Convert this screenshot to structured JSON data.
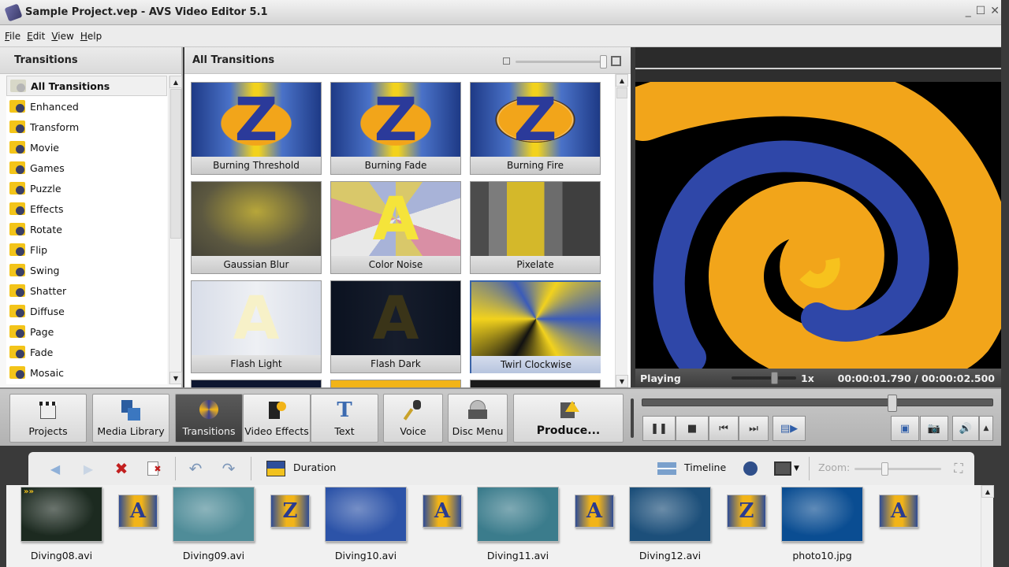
{
  "window": {
    "title": "Sample Project.vep - AVS Video Editor 5.1",
    "controls": {
      "minimize": "_",
      "maximize": "☐",
      "close": "✕"
    }
  },
  "menu": [
    "File",
    "Edit",
    "View",
    "Help"
  ],
  "left_panel": {
    "title": "Transitions",
    "categories": [
      {
        "label": "All Transitions",
        "selected": true
      },
      {
        "label": "Enhanced"
      },
      {
        "label": "Transform"
      },
      {
        "label": "Movie"
      },
      {
        "label": "Games"
      },
      {
        "label": "Puzzle"
      },
      {
        "label": "Effects"
      },
      {
        "label": "Rotate"
      },
      {
        "label": "Flip"
      },
      {
        "label": "Swing"
      },
      {
        "label": "Shatter"
      },
      {
        "label": "Diffuse"
      },
      {
        "label": "Page"
      },
      {
        "label": "Fade"
      },
      {
        "label": "Mosaic"
      }
    ]
  },
  "center_panel": {
    "title": "All Transitions",
    "thumbnail_size": 1.0,
    "transitions": [
      {
        "label": "Burning Threshold"
      },
      {
        "label": "Burning Fade"
      },
      {
        "label": "Burning Fire"
      },
      {
        "label": "Gaussian Blur"
      },
      {
        "label": "Color Noise"
      },
      {
        "label": "Pixelate"
      },
      {
        "label": "Flash Light"
      },
      {
        "label": "Flash Dark"
      },
      {
        "label": "Twirl Clockwise",
        "selected": true
      }
    ]
  },
  "preview": {
    "status": "Playing",
    "speed": "1x",
    "current_time": "00:00:01.790",
    "separator": "/",
    "total_time": "00:00:02.500",
    "playback_progress": 0.716
  },
  "toolbar": {
    "buttons": [
      {
        "label": "Projects",
        "icon": "clapperboard-icon"
      },
      {
        "label": "Media Library",
        "icon": "film-icon"
      },
      {
        "label": "Transitions",
        "icon": "transitions-icon",
        "active": true
      },
      {
        "label": "Video Effects",
        "icon": "video-effects-icon"
      },
      {
        "label": "Text",
        "icon": "text-icon"
      },
      {
        "label": "Voice",
        "icon": "microphone-icon"
      },
      {
        "label": "Disc Menu",
        "icon": "disc-icon"
      },
      {
        "label": "Produce...",
        "icon": "produce-icon"
      }
    ]
  },
  "player_controls": {
    "pause": "pause-icon",
    "stop": "stop-icon",
    "prev": "previous-icon",
    "next": "next-icon",
    "split": "split-video-icon",
    "fullscreen": "fullscreen-icon",
    "snapshot": "camera-icon",
    "volume": "volume-icon",
    "more": "expand-icon"
  },
  "timeline": {
    "duration_label": "Duration",
    "timeline_label": "Timeline",
    "zoom_label": "Zoom:",
    "zoom_level": 0.35,
    "clips": [
      {
        "label": "Diving08.avi",
        "color": "#1c2a20"
      },
      {
        "label": "Diving09.avi",
        "color": "#4f8c98"
      },
      {
        "label": "Diving10.avi",
        "color": "#2c53a8"
      },
      {
        "label": "Diving11.avi",
        "color": "#3b7c8c"
      },
      {
        "label": "Diving12.avi",
        "color": "#1c4f7a"
      },
      {
        "label": "photo10.jpg",
        "color": "#0a4d92"
      }
    ],
    "transitions": [
      "A",
      "Z",
      "A",
      "A",
      "Z",
      "A"
    ]
  }
}
